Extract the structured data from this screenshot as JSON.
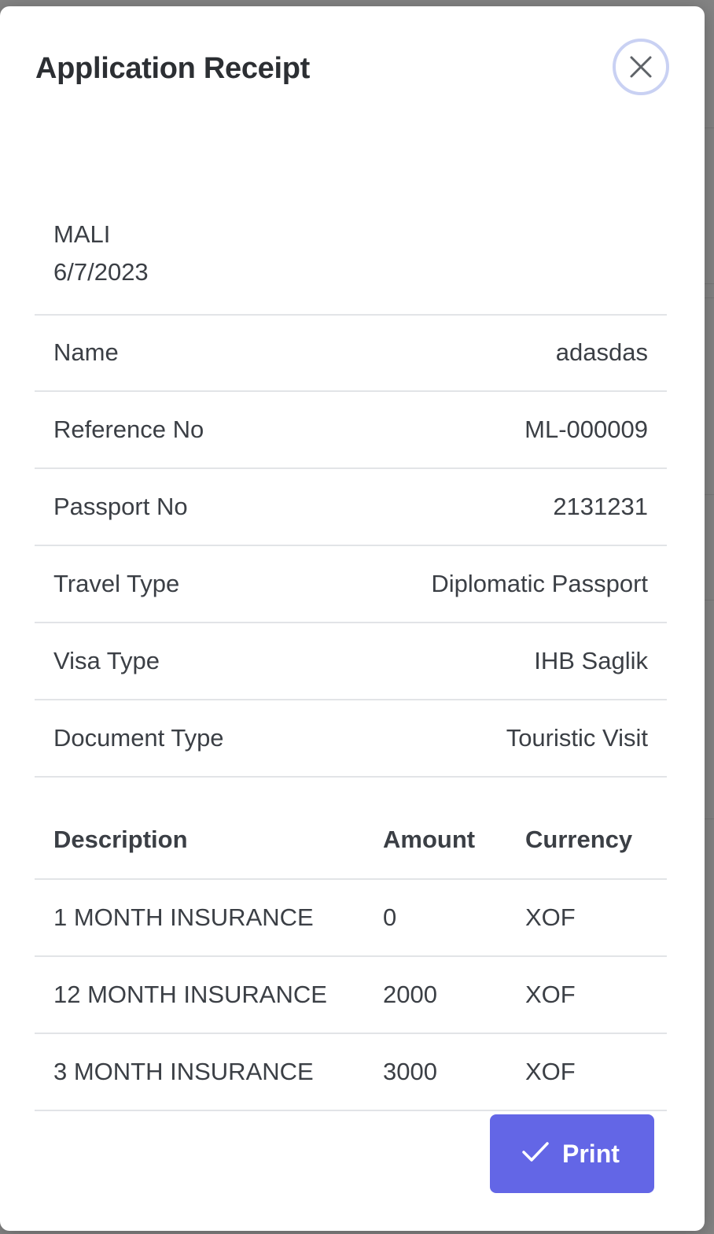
{
  "modal": {
    "title": "Application Receipt"
  },
  "receipt": {
    "country": "MALI",
    "date": "6/7/2023",
    "fields": [
      {
        "label": "Name",
        "value": "adasdas"
      },
      {
        "label": "Reference No",
        "value": "ML-000009"
      },
      {
        "label": "Passport No",
        "value": "2131231"
      },
      {
        "label": "Travel Type",
        "value": "Diplomatic Passport"
      },
      {
        "label": "Visa Type",
        "value": "IHB Saglik"
      },
      {
        "label": "Document Type",
        "value": "Touristic Visit"
      }
    ]
  },
  "fees_table": {
    "headers": {
      "description": "Description",
      "amount": "Amount",
      "currency": "Currency"
    },
    "rows": [
      {
        "description": "1 MONTH INSURANCE",
        "amount": "0",
        "currency": "XOF"
      },
      {
        "description": "12 MONTH INSURANCE",
        "amount": "2000",
        "currency": "XOF"
      },
      {
        "description": "3 MONTH INSURANCE",
        "amount": "3000",
        "currency": "XOF"
      }
    ]
  },
  "actions": {
    "print_label": "Print"
  },
  "icons": {
    "close": "close-icon",
    "print": "check-icon"
  },
  "colors": {
    "primary": "#6366e6",
    "close_ring": "#c9d1f3",
    "text": "#3b3f45",
    "divider": "#e2e4e7"
  }
}
